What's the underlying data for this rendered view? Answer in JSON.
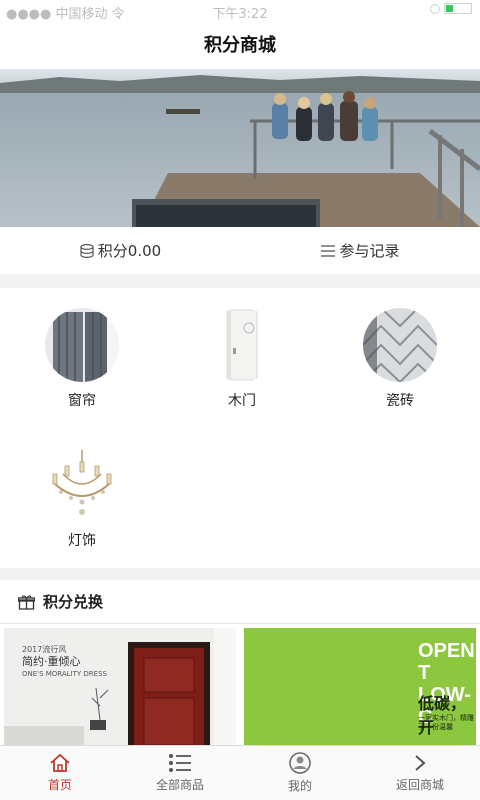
{
  "status_bar": {
    "carrier": "●●●● 中国移动 令",
    "time": "下午3:22"
  },
  "header": {
    "title": "积分商城"
  },
  "points_bar": {
    "points_label": "积分0.00",
    "records_label": "参与记录"
  },
  "categories": [
    {
      "label": "窗帘",
      "icon": "curtain-image"
    },
    {
      "label": "木门",
      "icon": "door-image"
    },
    {
      "label": "瓷砖",
      "icon": "tile-image"
    },
    {
      "label": "灯饰",
      "icon": "chandelier-image"
    }
  ],
  "exchange": {
    "title": "积分兑换"
  },
  "products": [
    {
      "line1": "2017流行风",
      "line2": "简约·重倾心",
      "line3": "ONE'S MORALITY DRESS"
    },
    {
      "line1": "OPEN T",
      "line2": "LOW-C",
      "line3": "低碳，开",
      "line4": "一家实木门，精雕了一份温馨"
    }
  ],
  "tabbar": {
    "items": [
      {
        "label": "首页",
        "icon": "home-icon",
        "active": true
      },
      {
        "label": "全部商品",
        "icon": "list-icon",
        "active": false
      },
      {
        "label": "我的",
        "icon": "user-icon",
        "active": false
      },
      {
        "label": "返回商城",
        "icon": "chevron-right-icon",
        "active": false
      }
    ]
  },
  "colors": {
    "accent": "#c0392b",
    "lime": "#8dc63f"
  }
}
